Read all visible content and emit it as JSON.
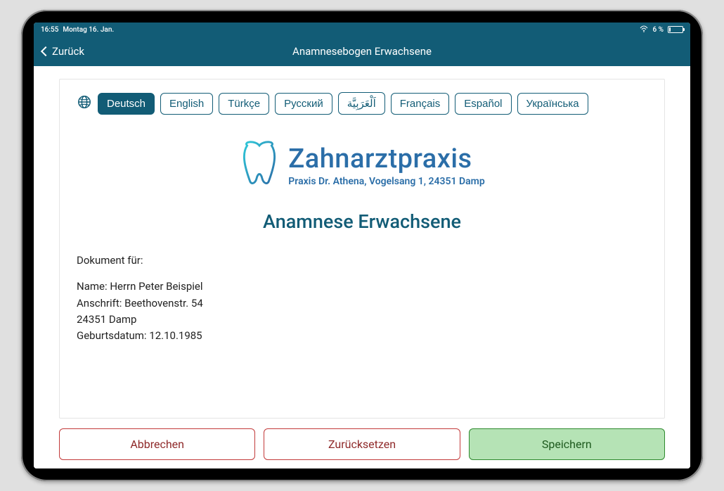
{
  "status": {
    "time": "16:55",
    "date": "Montag 16. Jan.",
    "battery_pct": "6 %"
  },
  "nav": {
    "back_label": "Zurück",
    "title": "Anamnesebogen Erwachsene"
  },
  "languages": [
    "Deutsch",
    "English",
    "Türkçe",
    "Русский",
    "اَلْعَرَبِيَّة",
    "Français",
    "Español",
    "Українська"
  ],
  "active_language_index": 0,
  "logo": {
    "title": "Zahnarztpraxis",
    "subtitle": "Praxis Dr. Athena, Vogelsang 1, 24351 Damp"
  },
  "document": {
    "title": "Anamnese Erwachsene",
    "for_label": "Dokument für:",
    "name_line": "Name: Herrn Peter Beispiel",
    "address_line": "Anschrift: Beethovenstr. 54",
    "city_line": "24351 Damp",
    "dob_line": "Geburtsdatum: 12.10.1985"
  },
  "footer": {
    "cancel": "Abbrechen",
    "reset": "Zurücksetzen",
    "save": "Speichern"
  }
}
